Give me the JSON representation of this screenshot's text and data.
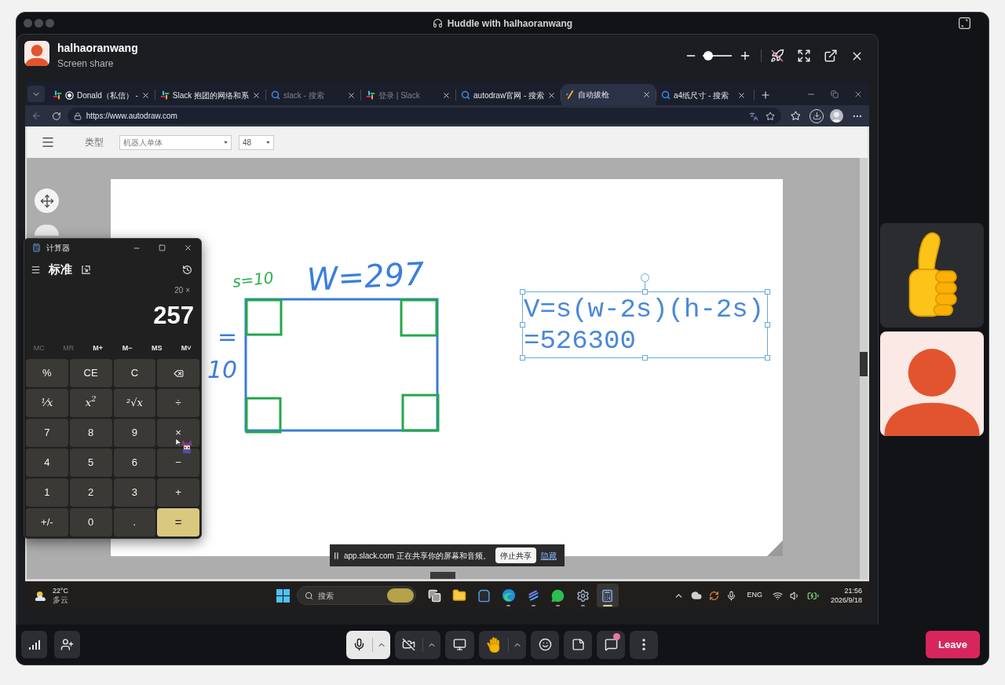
{
  "window": {
    "title": "Huddle with halhaoranwang"
  },
  "presenter": {
    "name": "halhaoranwang",
    "status": "Screen share"
  },
  "zoom_slider": {
    "level": 0.05
  },
  "browser": {
    "tabs": [
      {
        "kind": "slack",
        "label": "Donald（私信） -",
        "selected": false,
        "sleeping": false,
        "sharing": true
      },
      {
        "kind": "slack",
        "label": "Slack 抱团的网络和系",
        "selected": false,
        "sleeping": false,
        "sharing": false
      },
      {
        "kind": "search",
        "label": "slack - 搜索",
        "selected": false,
        "sleeping": true,
        "sharing": false
      },
      {
        "kind": "slack",
        "label": "登录 | Slack",
        "selected": false,
        "sleeping": true,
        "sharing": false
      },
      {
        "kind": "search",
        "label": "autodraw官网 - 搜索",
        "selected": false,
        "sleeping": false,
        "sharing": false
      },
      {
        "kind": "autodraw",
        "label": "自动拔枪",
        "selected": true,
        "sleeping": false,
        "sharing": false
      },
      {
        "kind": "search",
        "label": "a4纸尺寸 - 搜索",
        "selected": false,
        "sleeping": false,
        "sharing": false
      }
    ],
    "url": "https://www.autodraw.com"
  },
  "autodraw": {
    "font_label": "类型",
    "font": "机器人单体",
    "size": "48",
    "handwriting": [
      {
        "text": "s=10",
        "color": "#2bb24c"
      },
      {
        "text": "W=297",
        "color": "#3b7fdc"
      },
      {
        "text": "=",
        "color": "#3b7fdc"
      },
      {
        "text": "10",
        "color": "#3b7fdc"
      }
    ],
    "text_box": {
      "lines": [
        "V=s(w-2s)(h-2s)",
        "=526300"
      ],
      "selected": true
    }
  },
  "calculator": {
    "title": "计算器",
    "mode": "标准",
    "expression": "20 ×",
    "display": "257",
    "memory": [
      {
        "label": "MC",
        "disabled": true
      },
      {
        "label": "MR",
        "disabled": true
      },
      {
        "label": "M+",
        "disabled": false
      },
      {
        "label": "M−",
        "disabled": false
      },
      {
        "label": "MS",
        "disabled": false
      },
      {
        "label": "M˅",
        "disabled": false
      }
    ],
    "keys": [
      {
        "kind": "key",
        "label": "%"
      },
      {
        "kind": "key",
        "label": "CE"
      },
      {
        "kind": "key",
        "label": "C"
      },
      {
        "kind": "backspace"
      },
      {
        "kind": "math",
        "label": "⅟x"
      },
      {
        "kind": "math",
        "label": "x$^{2}$"
      },
      {
        "kind": "math",
        "label": "²√x"
      },
      {
        "kind": "key",
        "label": "÷"
      },
      {
        "kind": "key",
        "label": "7"
      },
      {
        "kind": "key",
        "label": "8"
      },
      {
        "kind": "key",
        "label": "9"
      },
      {
        "kind": "key",
        "label": "×"
      },
      {
        "kind": "key",
        "label": "4"
      },
      {
        "kind": "key",
        "label": "5"
      },
      {
        "kind": "key",
        "label": "6"
      },
      {
        "kind": "key",
        "label": "−"
      },
      {
        "kind": "key",
        "label": "1"
      },
      {
        "kind": "key",
        "label": "2"
      },
      {
        "kind": "key",
        "label": "3"
      },
      {
        "kind": "key",
        "label": "+"
      },
      {
        "kind": "key",
        "label": "+/-"
      },
      {
        "kind": "key",
        "label": "0"
      },
      {
        "kind": "key",
        "label": "."
      },
      {
        "kind": "equals",
        "label": "="
      }
    ]
  },
  "share_bar": {
    "message": "app.slack.com 正在共享你的屏幕和音频。",
    "stop_button": "停止共享",
    "hide_link": "隐藏"
  },
  "taskbar": {
    "temperature": "22°C",
    "weather": "多云",
    "search_placeholder": "搜索",
    "apps": [
      {
        "kind": "task-view",
        "running": false,
        "active": false
      },
      {
        "kind": "file-explorer",
        "running": false,
        "active": false
      },
      {
        "kind": "store",
        "running": false,
        "active": false
      },
      {
        "kind": "edge",
        "running": true,
        "active": false
      },
      {
        "kind": "stripes",
        "running": true,
        "active": false
      },
      {
        "kind": "wechat",
        "running": true,
        "active": false
      },
      {
        "kind": "settings",
        "running": true,
        "active": false
      },
      {
        "kind": "calculator",
        "running": true,
        "active": true
      }
    ],
    "language": "ENG",
    "time": "21:56",
    "date": "2026/9/18"
  },
  "call_controls": [
    {
      "kind": "mic",
      "highlighted": true,
      "menu": true,
      "badge": false
    },
    {
      "kind": "camera",
      "highlighted": false,
      "menu": true,
      "badge": false
    },
    {
      "kind": "screen",
      "highlighted": false,
      "menu": false,
      "badge": false
    },
    {
      "kind": "hand",
      "highlighted": false,
      "menu": true,
      "badge": false
    },
    {
      "kind": "emoji",
      "highlighted": false,
      "menu": false,
      "badge": false
    },
    {
      "kind": "note",
      "highlighted": false,
      "menu": false,
      "badge": false
    },
    {
      "kind": "chat",
      "highlighted": false,
      "menu": false,
      "badge": true
    },
    {
      "kind": "more",
      "highlighted": false,
      "menu": false,
      "badge": false
    }
  ],
  "leave_button": "Leave"
}
